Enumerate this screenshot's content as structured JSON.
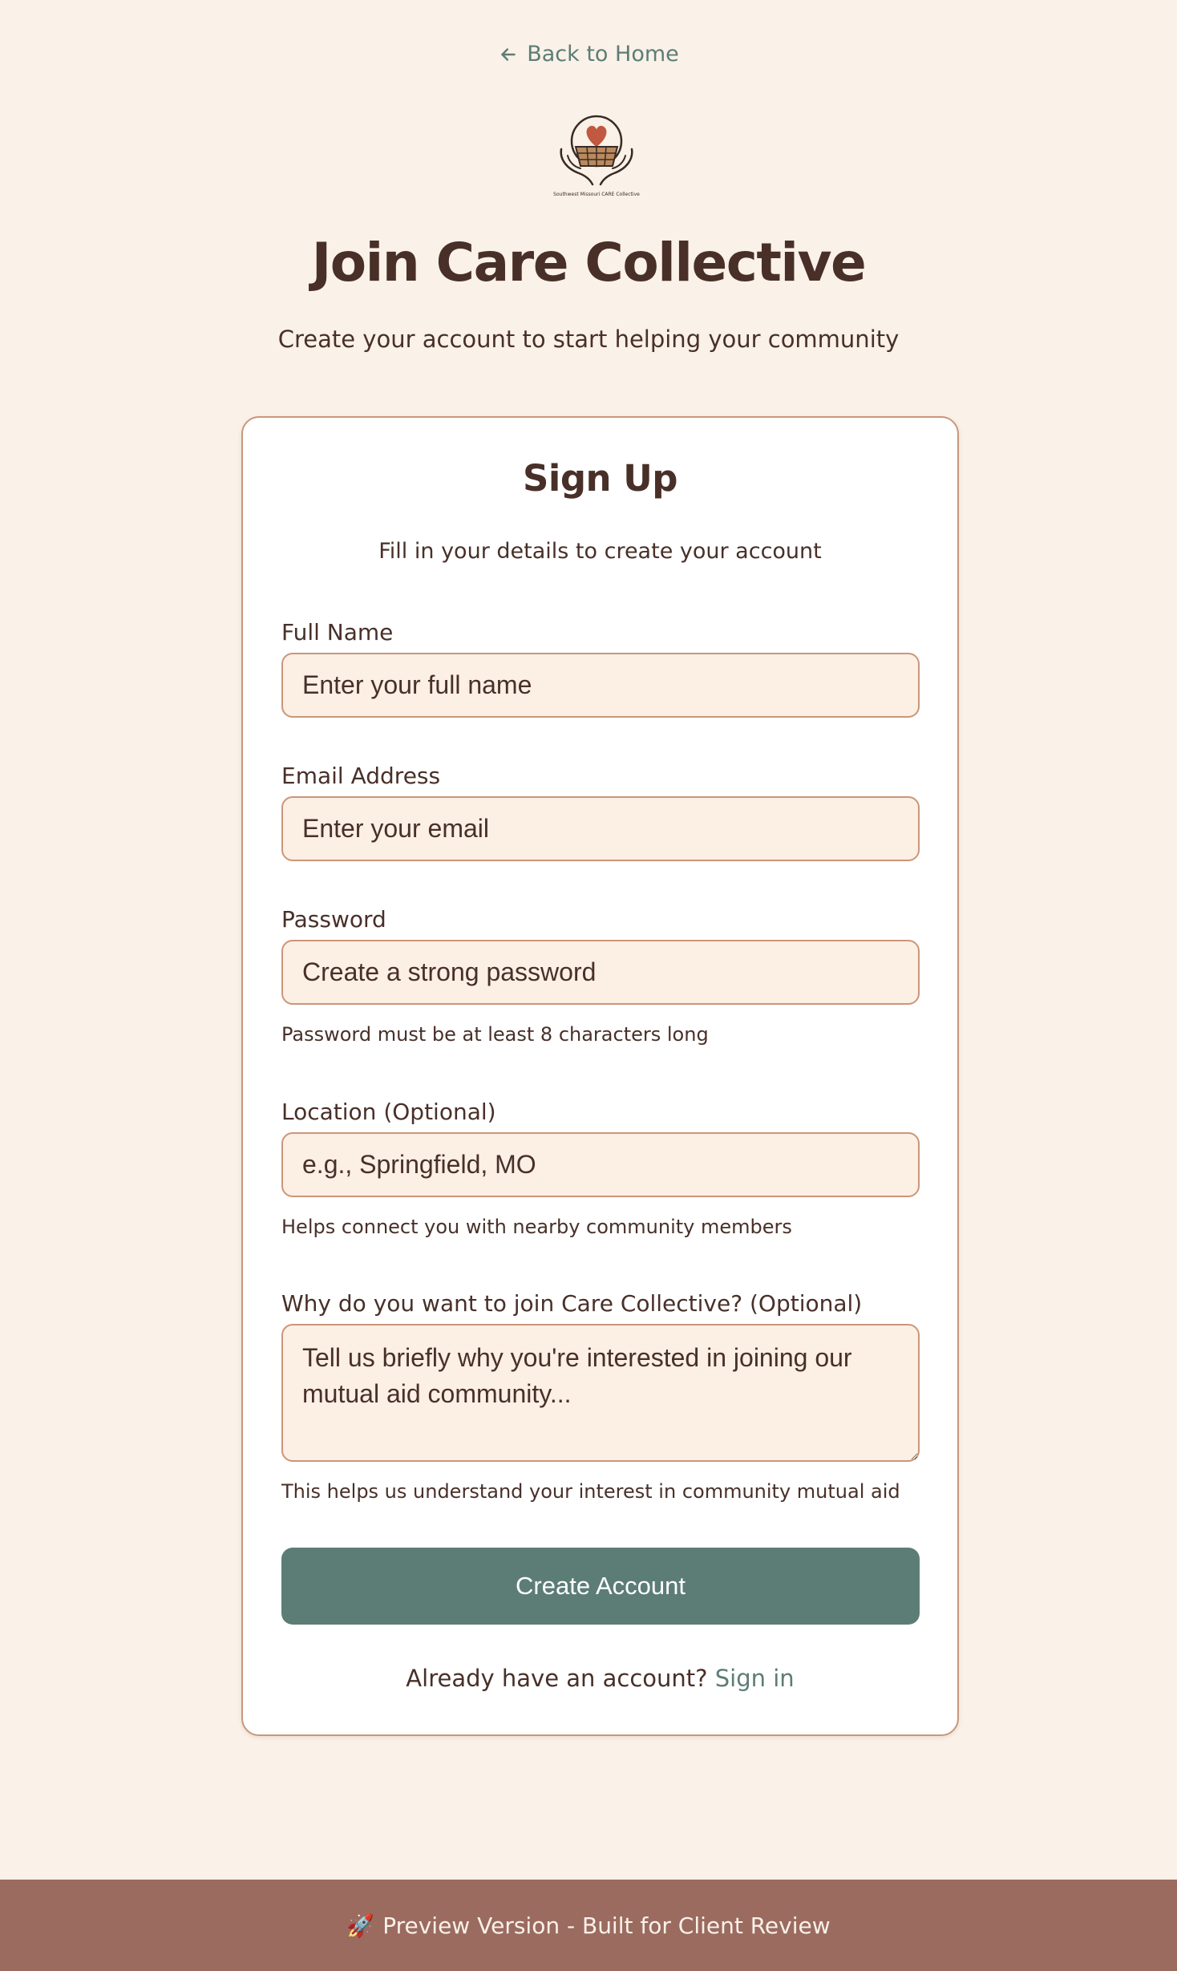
{
  "nav": {
    "back_label": "Back to Home"
  },
  "logo": {
    "text": "Southwest Missouri CARE Collective"
  },
  "header": {
    "title": "Join Care Collective",
    "subtitle": "Create your account to start helping your community"
  },
  "form": {
    "title": "Sign Up",
    "subtitle": "Fill in your details to create your account",
    "full_name": {
      "label": "Full Name",
      "placeholder": "Enter your full name"
    },
    "email": {
      "label": "Email Address",
      "placeholder": "Enter your email"
    },
    "password": {
      "label": "Password",
      "placeholder": "Create a strong password",
      "hint": "Password must be at least 8 characters long"
    },
    "location": {
      "label": "Location (Optional)",
      "placeholder": "e.g., Springfield, MO",
      "hint": "Helps connect you with nearby community members"
    },
    "reason": {
      "label": "Why do you want to join Care Collective? (Optional)",
      "placeholder": "Tell us briefly why you're interested in joining our mutual aid community...",
      "hint": "This helps us understand your interest in community mutual aid"
    },
    "submit_label": "Create Account",
    "signin_prompt": "Already have an account?",
    "signin_link": "Sign in"
  },
  "footer": {
    "icon": "🚀",
    "text": "Preview Version - Built for Client Review"
  },
  "colors": {
    "background": "#faf1e8",
    "text": "#483029",
    "accent": "#5c7d75",
    "border": "#c9977a",
    "input_bg": "#fcefe4",
    "footer_bg": "#9b6b60"
  }
}
